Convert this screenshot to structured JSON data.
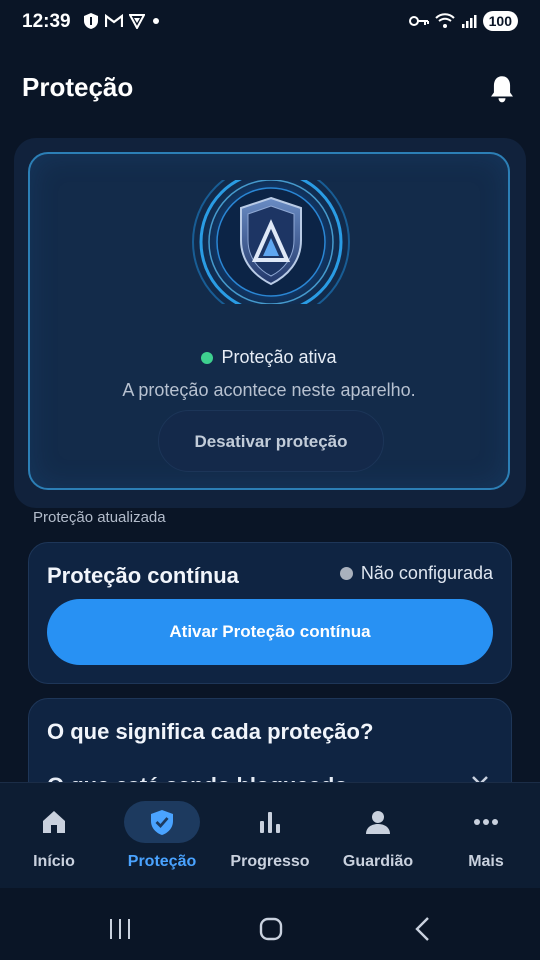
{
  "status_bar": {
    "time": "12:39",
    "battery": "100",
    "icons_left": [
      "shield-icon",
      "gmail-icon",
      "vpn-icon",
      "dot-icon"
    ],
    "icons_right": [
      "key-icon",
      "wifi-icon",
      "signal-icon"
    ]
  },
  "header": {
    "title": "Proteção",
    "bell_icon": "bell-icon"
  },
  "hero": {
    "status": "Proteção ativa",
    "status_color": "#3ed08f",
    "description": "A proteção acontece neste aparelho.",
    "deactivate_label": "Desativar proteção"
  },
  "updated_label": "Proteção atualizada",
  "continuous": {
    "title": "Proteção contínua",
    "status": "Não configurada",
    "activate_label": "Ativar Proteção contínua",
    "accent": "#2891f3"
  },
  "meaning": {
    "title": "O que significa cada proteção?",
    "subtitle": "O que está sendo bloqueado"
  },
  "nav": {
    "items": [
      {
        "label": "Início",
        "icon": "home-icon",
        "active": false
      },
      {
        "label": "Proteção",
        "icon": "shield-check-icon",
        "active": true
      },
      {
        "label": "Progresso",
        "icon": "bar-chart-icon",
        "active": false
      },
      {
        "label": "Guardião",
        "icon": "person-icon",
        "active": false
      },
      {
        "label": "Mais",
        "icon": "more-icon",
        "active": false
      }
    ]
  }
}
